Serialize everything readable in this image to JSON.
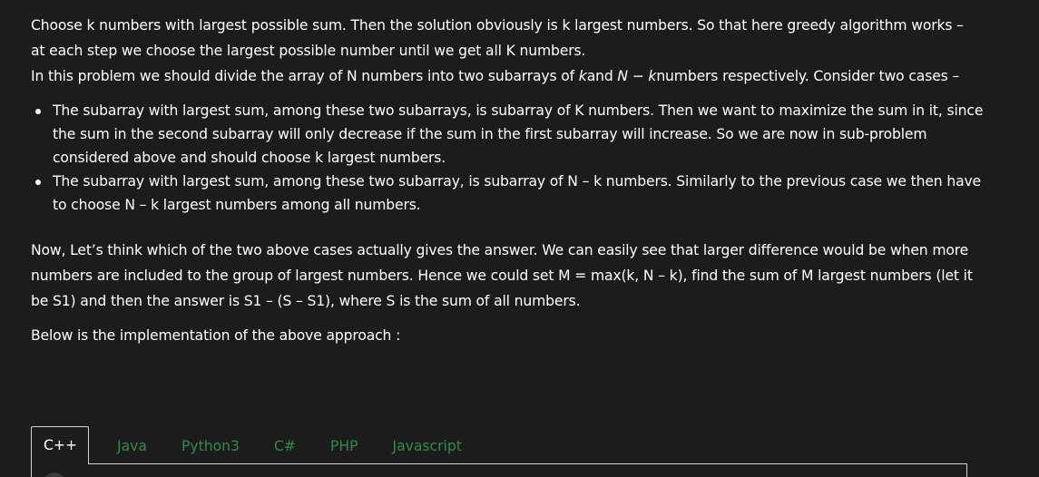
{
  "article": {
    "para1": {
      "line1": "Choose k numbers with largest possible sum. Then the solution obviously is k largest numbers. So that here greedy algorithm works –",
      "line2": "at each step we choose the largest possible number until we get all K numbers.",
      "line3_a": "In this problem we should divide the array of N numbers into two subarrays of ",
      "line3_k": "k",
      "line3_b": "and ",
      "line3_nk": "N − k",
      "line3_c": "numbers respectively. Consider two cases –"
    },
    "cases": [
      {
        "line1": "The subarray with largest sum, among these two subarrays, is subarray of K numbers. Then we want to maximize the sum in it, since",
        "line2": "the sum in the second subarray will only decrease if the sum in the first subarray will increase. So we are now in sub-problem",
        "line3": "considered above and should choose k largest numbers."
      },
      {
        "line1": "The subarray with largest sum, among these two subarray, is subarray of N – k numbers. Similarly to the previous case we then have",
        "line2": "to choose N – k largest numbers among all numbers."
      }
    ],
    "para2": {
      "line1": "Now, Let’s think which of the two above cases actually gives the answer. We can easily see that larger difference would be when more",
      "line2": "numbers are included to the group of largest numbers. Hence we could set M = max(k, N – k), find the sum of M largest numbers (let it",
      "line3": "be S1) and then the answer is S1 – (S – S1), where S is the sum of all numbers."
    },
    "para3": "Below is the implementation of the above approach :"
  },
  "tabs": [
    {
      "label": "C++",
      "active": true
    },
    {
      "label": "Java",
      "active": false
    },
    {
      "label": "Python3",
      "active": false
    },
    {
      "label": "C#",
      "active": false
    },
    {
      "label": "PHP",
      "active": false
    },
    {
      "label": "Javascript",
      "active": false
    }
  ],
  "colors": {
    "background": "#1c1c1c",
    "text": "#ffffff",
    "tab_inactive": "#2f8d46",
    "border": "#d4d4d4"
  }
}
